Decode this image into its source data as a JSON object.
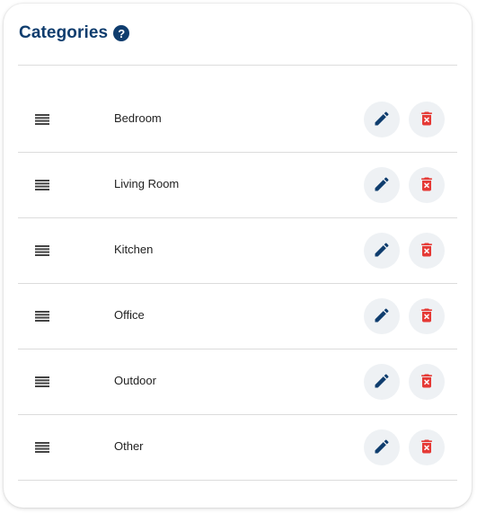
{
  "header": {
    "title": "Categories",
    "help_glyph": "?"
  },
  "colors": {
    "title": "#0f3d6e",
    "edit_icon": "#0f3d6e",
    "delete_icon": "#e53935",
    "button_bg": "#eef1f4"
  },
  "icons": {
    "help": "help-circle-icon",
    "drag": "drag-handle-icon",
    "edit": "pencil-icon",
    "delete": "trash-icon"
  },
  "categories": [
    {
      "label": "Bedroom"
    },
    {
      "label": "Living Room"
    },
    {
      "label": "Kitchen"
    },
    {
      "label": "Office"
    },
    {
      "label": "Outdoor"
    },
    {
      "label": "Other"
    }
  ]
}
